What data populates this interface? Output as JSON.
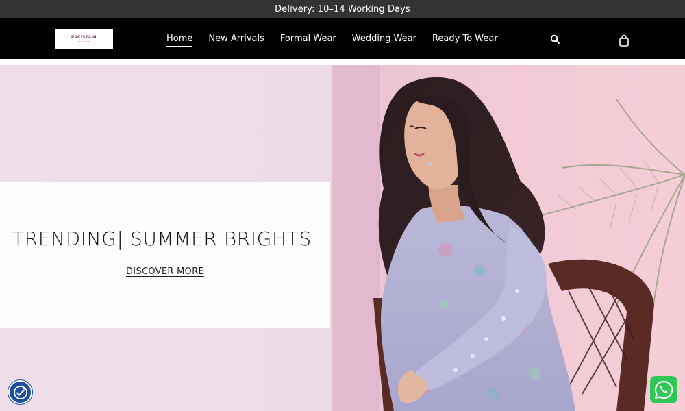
{
  "announcement": {
    "text": "Delivery: 10–14 Working Days"
  },
  "header": {
    "logo": {
      "main": "PAKISTANI",
      "sub": "CLOTHES"
    },
    "nav": [
      {
        "label": "Home",
        "active": true
      },
      {
        "label": "New Arrivals",
        "active": false
      },
      {
        "label": "Formal Wear",
        "active": false
      },
      {
        "label": "Wedding Wear",
        "active": false
      },
      {
        "label": "Ready To Wear",
        "active": false
      }
    ],
    "icons": {
      "search": "search-icon",
      "cart": "shopping-bag-icon"
    }
  },
  "hero": {
    "title": "TRENDING| SUMMER BRIGHTS",
    "cta": "DISCOVER MORE",
    "image": "woman-in-lavender-embroidered-outfit-seated-on-wicker-chair"
  },
  "floating": {
    "accessibility_icon": "accessibility-icon",
    "whatsapp_icon": "whatsapp-icon"
  },
  "colors": {
    "announce_bg": "#333333",
    "header_bg": "#000000",
    "whatsapp_green": "#2ec855",
    "accessibility_blue": "#1d4ea0"
  }
}
